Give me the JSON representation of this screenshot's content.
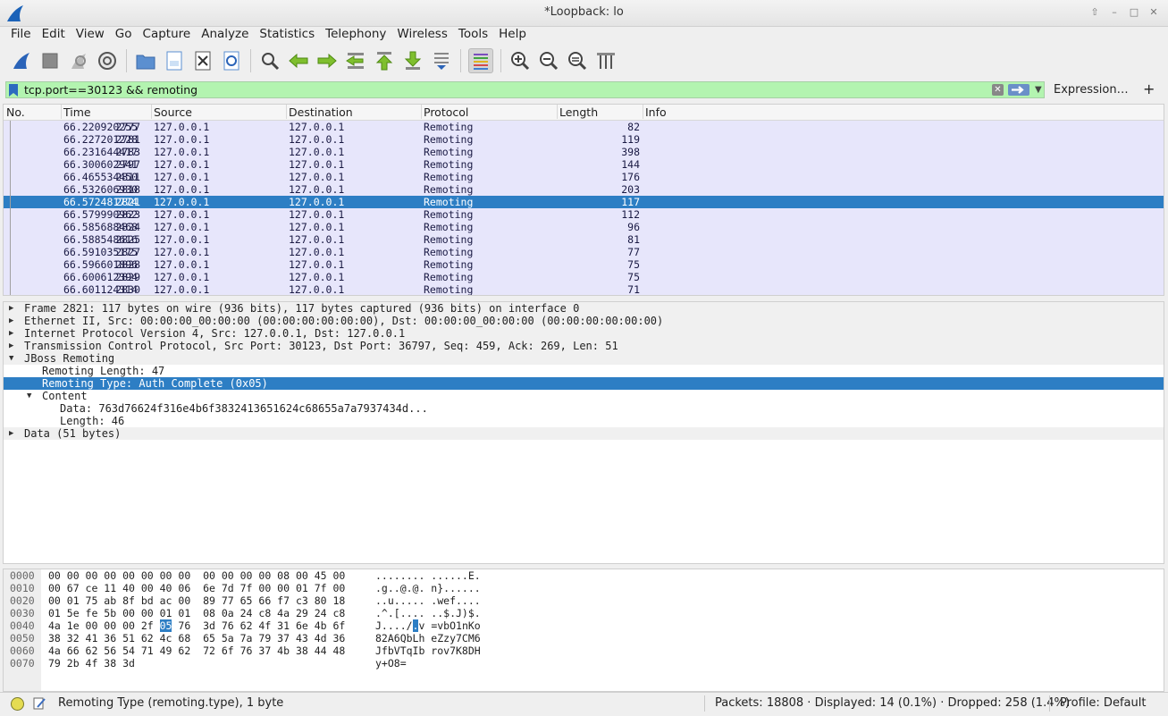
{
  "window": {
    "title": "*Loopback: lo"
  },
  "menu": [
    "File",
    "Edit",
    "View",
    "Go",
    "Capture",
    "Analyze",
    "Statistics",
    "Telephony",
    "Wireless",
    "Tools",
    "Help"
  ],
  "filter": {
    "value": "tcp.port==30123 && remoting",
    "expression_label": "Expression…",
    "plus_label": "+"
  },
  "columns": [
    "No.",
    "Time",
    "Source",
    "Destination",
    "Protocol",
    "Length",
    "Info"
  ],
  "packets": [
    {
      "no": "2777",
      "time": "66.220920255",
      "src": "127.0.0.1",
      "dst": "127.0.0.1",
      "proto": "Remoting",
      "len": "82",
      "selected": false
    },
    {
      "no": "2781",
      "time": "66.227201228",
      "src": "127.0.0.1",
      "dst": "127.0.0.1",
      "proto": "Remoting",
      "len": "119",
      "selected": false
    },
    {
      "no": "2783",
      "time": "66.231644417",
      "src": "127.0.0.1",
      "dst": "127.0.0.1",
      "proto": "Remoting",
      "len": "398",
      "selected": false
    },
    {
      "no": "2797",
      "time": "66.300602941",
      "src": "127.0.0.1",
      "dst": "127.0.0.1",
      "proto": "Remoting",
      "len": "144",
      "selected": false
    },
    {
      "no": "2811",
      "time": "66.465534450",
      "src": "127.0.0.1",
      "dst": "127.0.0.1",
      "proto": "Remoting",
      "len": "176",
      "selected": false
    },
    {
      "no": "2818",
      "time": "66.532606930",
      "src": "127.0.0.1",
      "dst": "127.0.0.1",
      "proto": "Remoting",
      "len": "203",
      "selected": false
    },
    {
      "no": "2821",
      "time": "66.572481774",
      "src": "127.0.0.1",
      "dst": "127.0.0.1",
      "proto": "Remoting",
      "len": "117",
      "selected": true
    },
    {
      "no": "2823",
      "time": "66.579990962",
      "src": "127.0.0.1",
      "dst": "127.0.0.1",
      "proto": "Remoting",
      "len": "112",
      "selected": false
    },
    {
      "no": "2824",
      "time": "66.585688468",
      "src": "127.0.0.1",
      "dst": "127.0.0.1",
      "proto": "Remoting",
      "len": "96",
      "selected": false
    },
    {
      "no": "2825",
      "time": "66.588548616",
      "src": "127.0.0.1",
      "dst": "127.0.0.1",
      "proto": "Remoting",
      "len": "81",
      "selected": false
    },
    {
      "no": "2827",
      "time": "66.591035175",
      "src": "127.0.0.1",
      "dst": "127.0.0.1",
      "proto": "Remoting",
      "len": "77",
      "selected": false
    },
    {
      "no": "2828",
      "time": "66.596601896",
      "src": "127.0.0.1",
      "dst": "127.0.0.1",
      "proto": "Remoting",
      "len": "75",
      "selected": false
    },
    {
      "no": "2829",
      "time": "66.600612394",
      "src": "127.0.0.1",
      "dst": "127.0.0.1",
      "proto": "Remoting",
      "len": "75",
      "selected": false
    },
    {
      "no": "2830",
      "time": "66.601124314",
      "src": "127.0.0.1",
      "dst": "127.0.0.1",
      "proto": "Remoting",
      "len": "71",
      "selected": false
    }
  ],
  "details": [
    {
      "text": "Frame 2821: 117 bytes on wire (936 bits), 117 bytes captured (936 bits) on interface 0",
      "level": 0,
      "expander": "closed",
      "grey": true,
      "selected": false
    },
    {
      "text": "Ethernet II, Src: 00:00:00_00:00:00 (00:00:00:00:00:00), Dst: 00:00:00_00:00:00 (00:00:00:00:00:00)",
      "level": 0,
      "expander": "closed",
      "grey": true,
      "selected": false
    },
    {
      "text": "Internet Protocol Version 4, Src: 127.0.0.1, Dst: 127.0.0.1",
      "level": 0,
      "expander": "closed",
      "grey": true,
      "selected": false
    },
    {
      "text": "Transmission Control Protocol, Src Port: 30123, Dst Port: 36797, Seq: 459, Ack: 269, Len: 51",
      "level": 0,
      "expander": "closed",
      "grey": true,
      "selected": false
    },
    {
      "text": "JBoss Remoting",
      "level": 0,
      "expander": "open",
      "grey": true,
      "selected": false
    },
    {
      "text": "Remoting Length: 47",
      "level": 1,
      "expander": "none",
      "grey": false,
      "selected": false
    },
    {
      "text": "Remoting Type: Auth Complete (0x05)",
      "level": 1,
      "expander": "none",
      "grey": false,
      "selected": true
    },
    {
      "text": "Content",
      "level": 1,
      "expander": "open",
      "grey": false,
      "selected": false
    },
    {
      "text": "Data: 763d76624f316e4b6f3832413651624c68655a7a7937434d...",
      "level": 2,
      "expander": "none",
      "grey": false,
      "selected": false
    },
    {
      "text": "Length: 46",
      "level": 2,
      "expander": "none",
      "grey": false,
      "selected": false
    },
    {
      "text": "Data (51 bytes)",
      "level": 0,
      "expander": "closed",
      "grey": true,
      "selected": false
    }
  ],
  "bytes": [
    {
      "off": "0000",
      "hex_a": "00 00 00 00 00 00 00 00  00 00 00 00 08 00 45 00",
      "hl": "",
      "hex_b": "",
      "ascii_a": "........ ......E.",
      "ahl": "",
      "ascii_b": ""
    },
    {
      "off": "0010",
      "hex_a": "00 67 ce 11 40 00 40 06  6e 7d 7f 00 00 01 7f 00",
      "hl": "",
      "hex_b": "",
      "ascii_a": ".g..@.@. n}......",
      "ahl": "",
      "ascii_b": ""
    },
    {
      "off": "0020",
      "hex_a": "00 01 75 ab 8f bd ac 00  89 77 65 66 f7 c3 80 18",
      "hl": "",
      "hex_b": "",
      "ascii_a": "..u..... .wef....",
      "ahl": "",
      "ascii_b": ""
    },
    {
      "off": "0030",
      "hex_a": "01 5e fe 5b 00 00 01 01  08 0a 24 c8 4a 29 24 c8",
      "hl": "",
      "hex_b": "",
      "ascii_a": ".^.[.... ..$.J)$.",
      "ahl": "",
      "ascii_b": ""
    },
    {
      "off": "0040",
      "hex_a": "4a 1e 00 00 00 2f ",
      "hl": "05",
      "hex_b": " 76  3d 76 62 4f 31 6e 4b 6f",
      "ascii_a": "J..../",
      "ahl": ".",
      "ascii_b": "v =vbO1nKo"
    },
    {
      "off": "0050",
      "hex_a": "38 32 41 36 51 62 4c 68  65 5a 7a 79 37 43 4d 36",
      "hl": "",
      "hex_b": "",
      "ascii_a": "82A6QbLh eZzy7CM6",
      "ahl": "",
      "ascii_b": ""
    },
    {
      "off": "0060",
      "hex_a": "4a 66 62 56 54 71 49 62  72 6f 76 37 4b 38 44 48",
      "hl": "",
      "hex_b": "",
      "ascii_a": "JfbVTqIb rov7K8DH",
      "ahl": "",
      "ascii_b": ""
    },
    {
      "off": "0070",
      "hex_a": "79 2b 4f 38 3d",
      "hl": "",
      "hex_b": "",
      "ascii_a": "y+O8=",
      "ahl": "",
      "ascii_b": ""
    }
  ],
  "status": {
    "field_info": "Remoting Type (remoting.type), 1 byte",
    "packets": "Packets: 18808 · Displayed: 14 (0.1%) · Dropped: 258 (1.4%)",
    "profile": "Profile: Default"
  },
  "colors": {
    "row_bg": "#e7e6fb",
    "selected": "#2d7ec4",
    "filter_valid": "#b3f4b0",
    "expert_led": "#e5dc52"
  },
  "icons": [
    "shark-fin-start-icon",
    "stop-icon",
    "restart-icon",
    "capture-options-icon",
    "open-file-icon",
    "save-file-icon",
    "close-file-icon",
    "reload-icon",
    "find-icon",
    "go-back-icon",
    "go-forward-icon",
    "go-to-packet-icon",
    "first-packet-icon",
    "last-packet-icon",
    "autoscroll-icon",
    "colorize-icon",
    "zoom-in-icon",
    "zoom-out-icon",
    "normal-size-icon",
    "resize-columns-icon"
  ]
}
